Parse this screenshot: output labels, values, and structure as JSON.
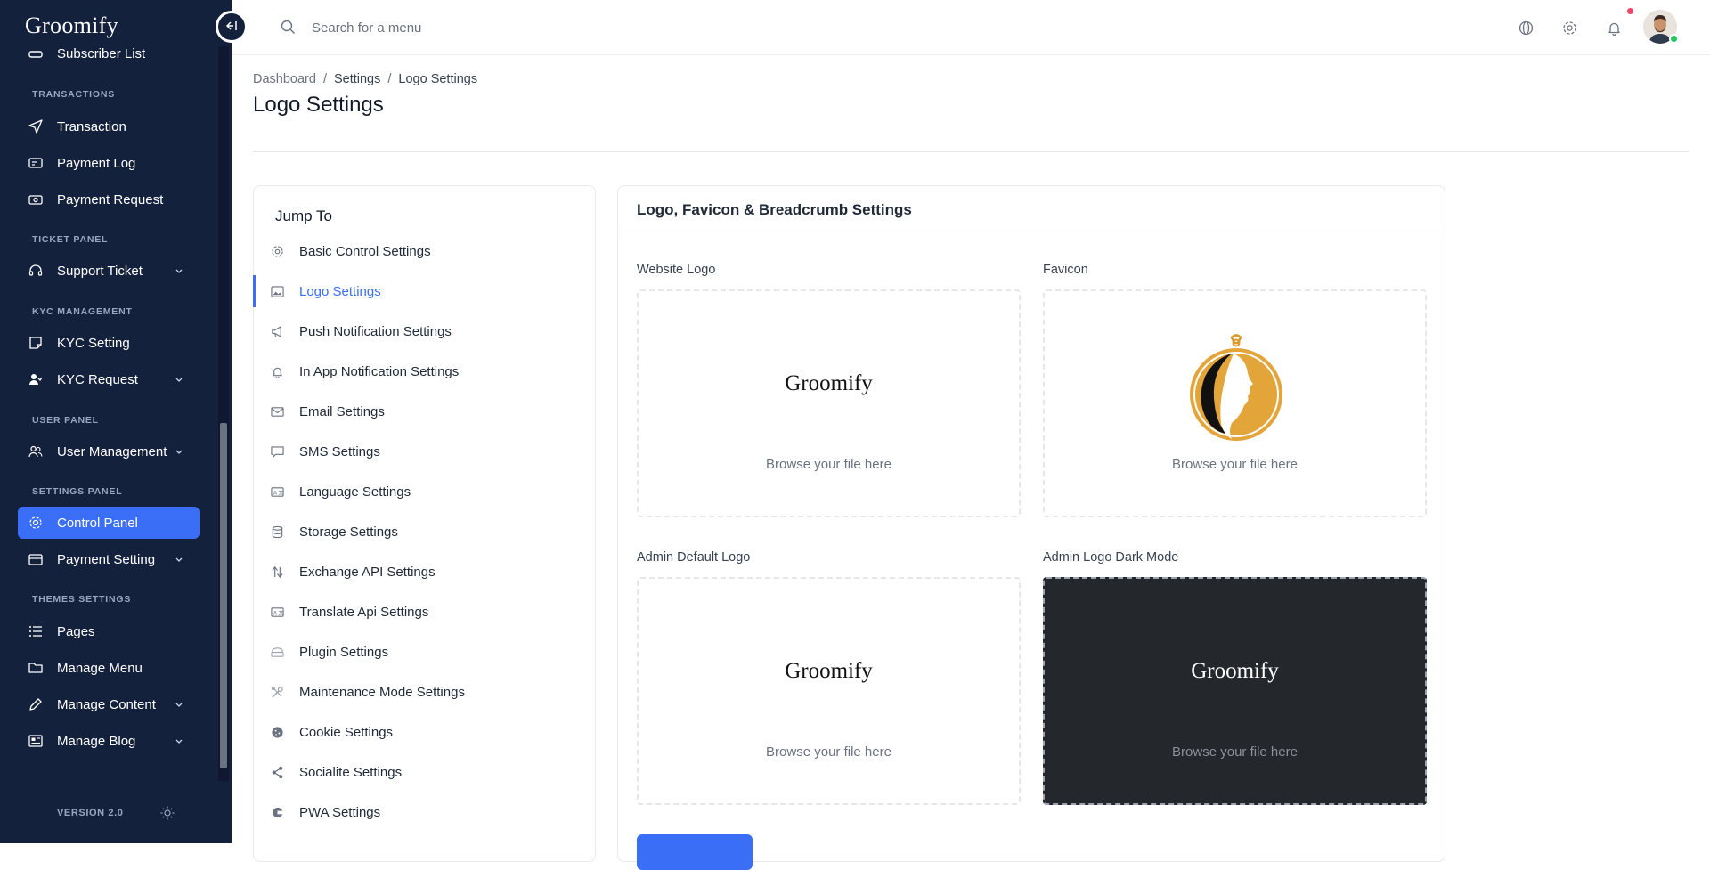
{
  "app": {
    "logo": "Groomify"
  },
  "sidebar": {
    "partial_item": "Subscriber List",
    "sections": {
      "transactions": "TRANSACTIONS",
      "ticket": "TICKET PANEL",
      "kyc": "KYC MANAGEMENT",
      "user": "USER PANEL",
      "settings": "SETTINGS PANEL",
      "themes": "THEMES SETTINGS"
    },
    "items": {
      "transaction": "Transaction",
      "payment_log": "Payment Log",
      "payment_request": "Payment Request",
      "support_ticket": "Support Ticket",
      "kyc_setting": "KYC Setting",
      "kyc_request": "KYC Request",
      "user_management": "User Management",
      "control_panel": "Control Panel",
      "payment_setting": "Payment Setting",
      "pages": "Pages",
      "manage_menu": "Manage Menu",
      "manage_content": "Manage Content",
      "manage_blog": "Manage Blog"
    },
    "version": "VERSION 2.0"
  },
  "search": {
    "placeholder": "Search for a menu"
  },
  "breadcrumb": {
    "items": [
      "Dashboard",
      "Settings",
      "Logo Settings"
    ],
    "separator": "/"
  },
  "page": {
    "title": "Logo Settings"
  },
  "jump": {
    "title": "Jump To",
    "items": [
      "Basic Control Settings",
      "Logo Settings",
      "Push Notification Settings",
      "In App Notification Settings",
      "Email Settings",
      "SMS Settings",
      "Language Settings",
      "Storage Settings",
      "Exchange API Settings",
      "Translate Api Settings",
      "Plugin Settings",
      "Maintenance Mode Settings",
      "Cookie Settings",
      "Socialite Settings",
      "PWA Settings"
    ]
  },
  "card": {
    "title": "Logo, Favicon & Breadcrumb Settings",
    "fields": {
      "website_logo": "Website Logo",
      "favicon": "Favicon",
      "admin_default_logo": "Admin Default Logo",
      "admin_logo_dark": "Admin Logo Dark Mode"
    },
    "browse_text": "Browse your file here"
  },
  "colors": {
    "sidebar_bg": "#14213d",
    "accent": "#3b6ef6",
    "notif_dot": "#ef4467",
    "online": "#22c55e",
    "favicon_gold": "#e0a030"
  }
}
